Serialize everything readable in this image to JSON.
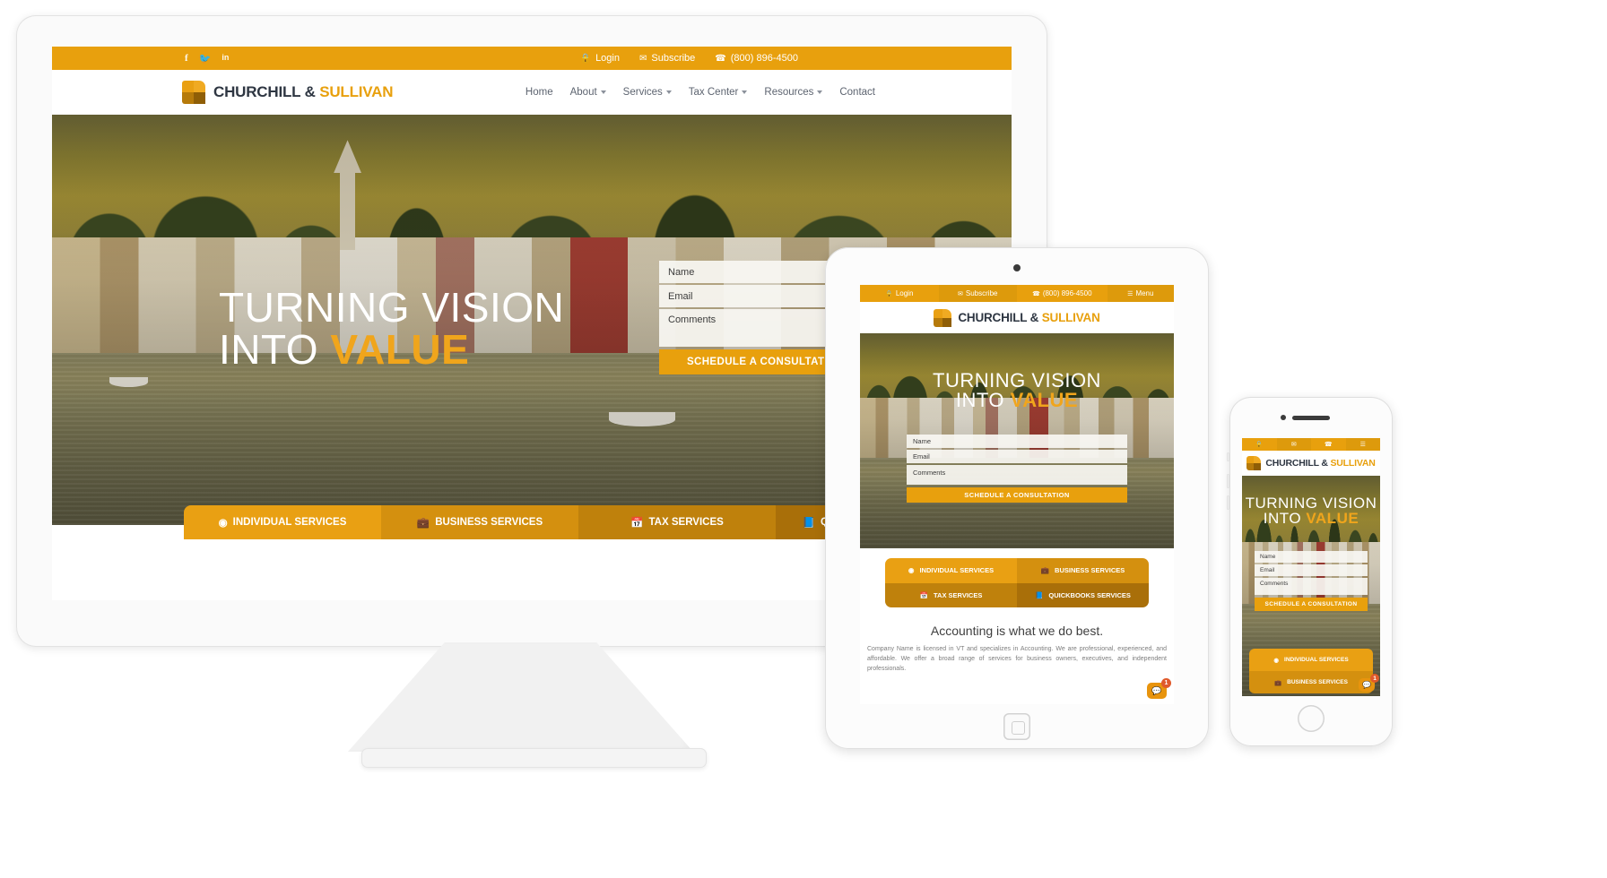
{
  "brand": {
    "name_part1": "CHURCHILL",
    "amp": "&",
    "name_part2": "SULLIVAN",
    "logo_icon": "square-logo-icon"
  },
  "colors": {
    "accent": "#e8a00d",
    "accent_light": "#f0aa22",
    "accent_dark": "#b67a0a",
    "headline_highlight": "#f0a51c",
    "badge": "#e05a2b",
    "nav_text": "#5d6470",
    "brand_text": "#2e3642"
  },
  "topbar": {
    "social": [
      {
        "name": "facebook-icon",
        "glyph": "f"
      },
      {
        "name": "twitter-icon",
        "glyph": "t"
      },
      {
        "name": "linkedin-icon",
        "glyph": "in"
      }
    ],
    "login_label": "Login",
    "login_icon": "lock-icon",
    "subscribe_label": "Subscribe",
    "subscribe_icon": "envelope-icon",
    "phone_label": "(800) 896-4500",
    "phone_icon": "phone-icon",
    "menu_label": "Menu",
    "menu_icon": "hamburger-icon"
  },
  "nav": {
    "items": [
      {
        "label": "Home",
        "caret": false
      },
      {
        "label": "About",
        "caret": true
      },
      {
        "label": "Services",
        "caret": true
      },
      {
        "label": "Tax Center",
        "caret": true
      },
      {
        "label": "Resources",
        "caret": true
      },
      {
        "label": "Contact",
        "caret": false
      }
    ]
  },
  "hero": {
    "line1": "TURNING VISION",
    "line2_plain": "INTO ",
    "line2_highlight": "VALUE"
  },
  "form": {
    "name_placeholder": "Name",
    "email_placeholder": "Email",
    "comments_placeholder": "Comments",
    "submit_label": "SCHEDULE A CONSULTATION"
  },
  "service_tabs": [
    {
      "label": "INDIVIDUAL SERVICES",
      "icon": "person-circle-icon",
      "glyph": "◉",
      "color": "#e9a013"
    },
    {
      "label": "BUSINESS SERVICES",
      "icon": "briefcase-icon",
      "glyph": "▬",
      "color": "#d4900f"
    },
    {
      "label": "TAX SERVICES",
      "icon": "calendar-icon",
      "glyph": "☷",
      "color": "#bf810c"
    },
    {
      "label": "QUICKBOOKS SERVICES",
      "icon": "book-icon",
      "glyph": "◧",
      "color": "#a96f09"
    }
  ],
  "content": {
    "heading": "Accounting is what we do best.",
    "paragraph": "Company Name is licensed in VT and specializes in Accounting. We are professional, experienced, and affordable. We offer a broad range of services for business owners, executives, and independent professionals."
  },
  "chat": {
    "icon": "chat-bubble-icon",
    "glyph": "●●",
    "badge_count": "1"
  },
  "devices": {
    "monitor": "desktop-monitor",
    "tablet": "tablet-device",
    "phone": "phone-device"
  }
}
